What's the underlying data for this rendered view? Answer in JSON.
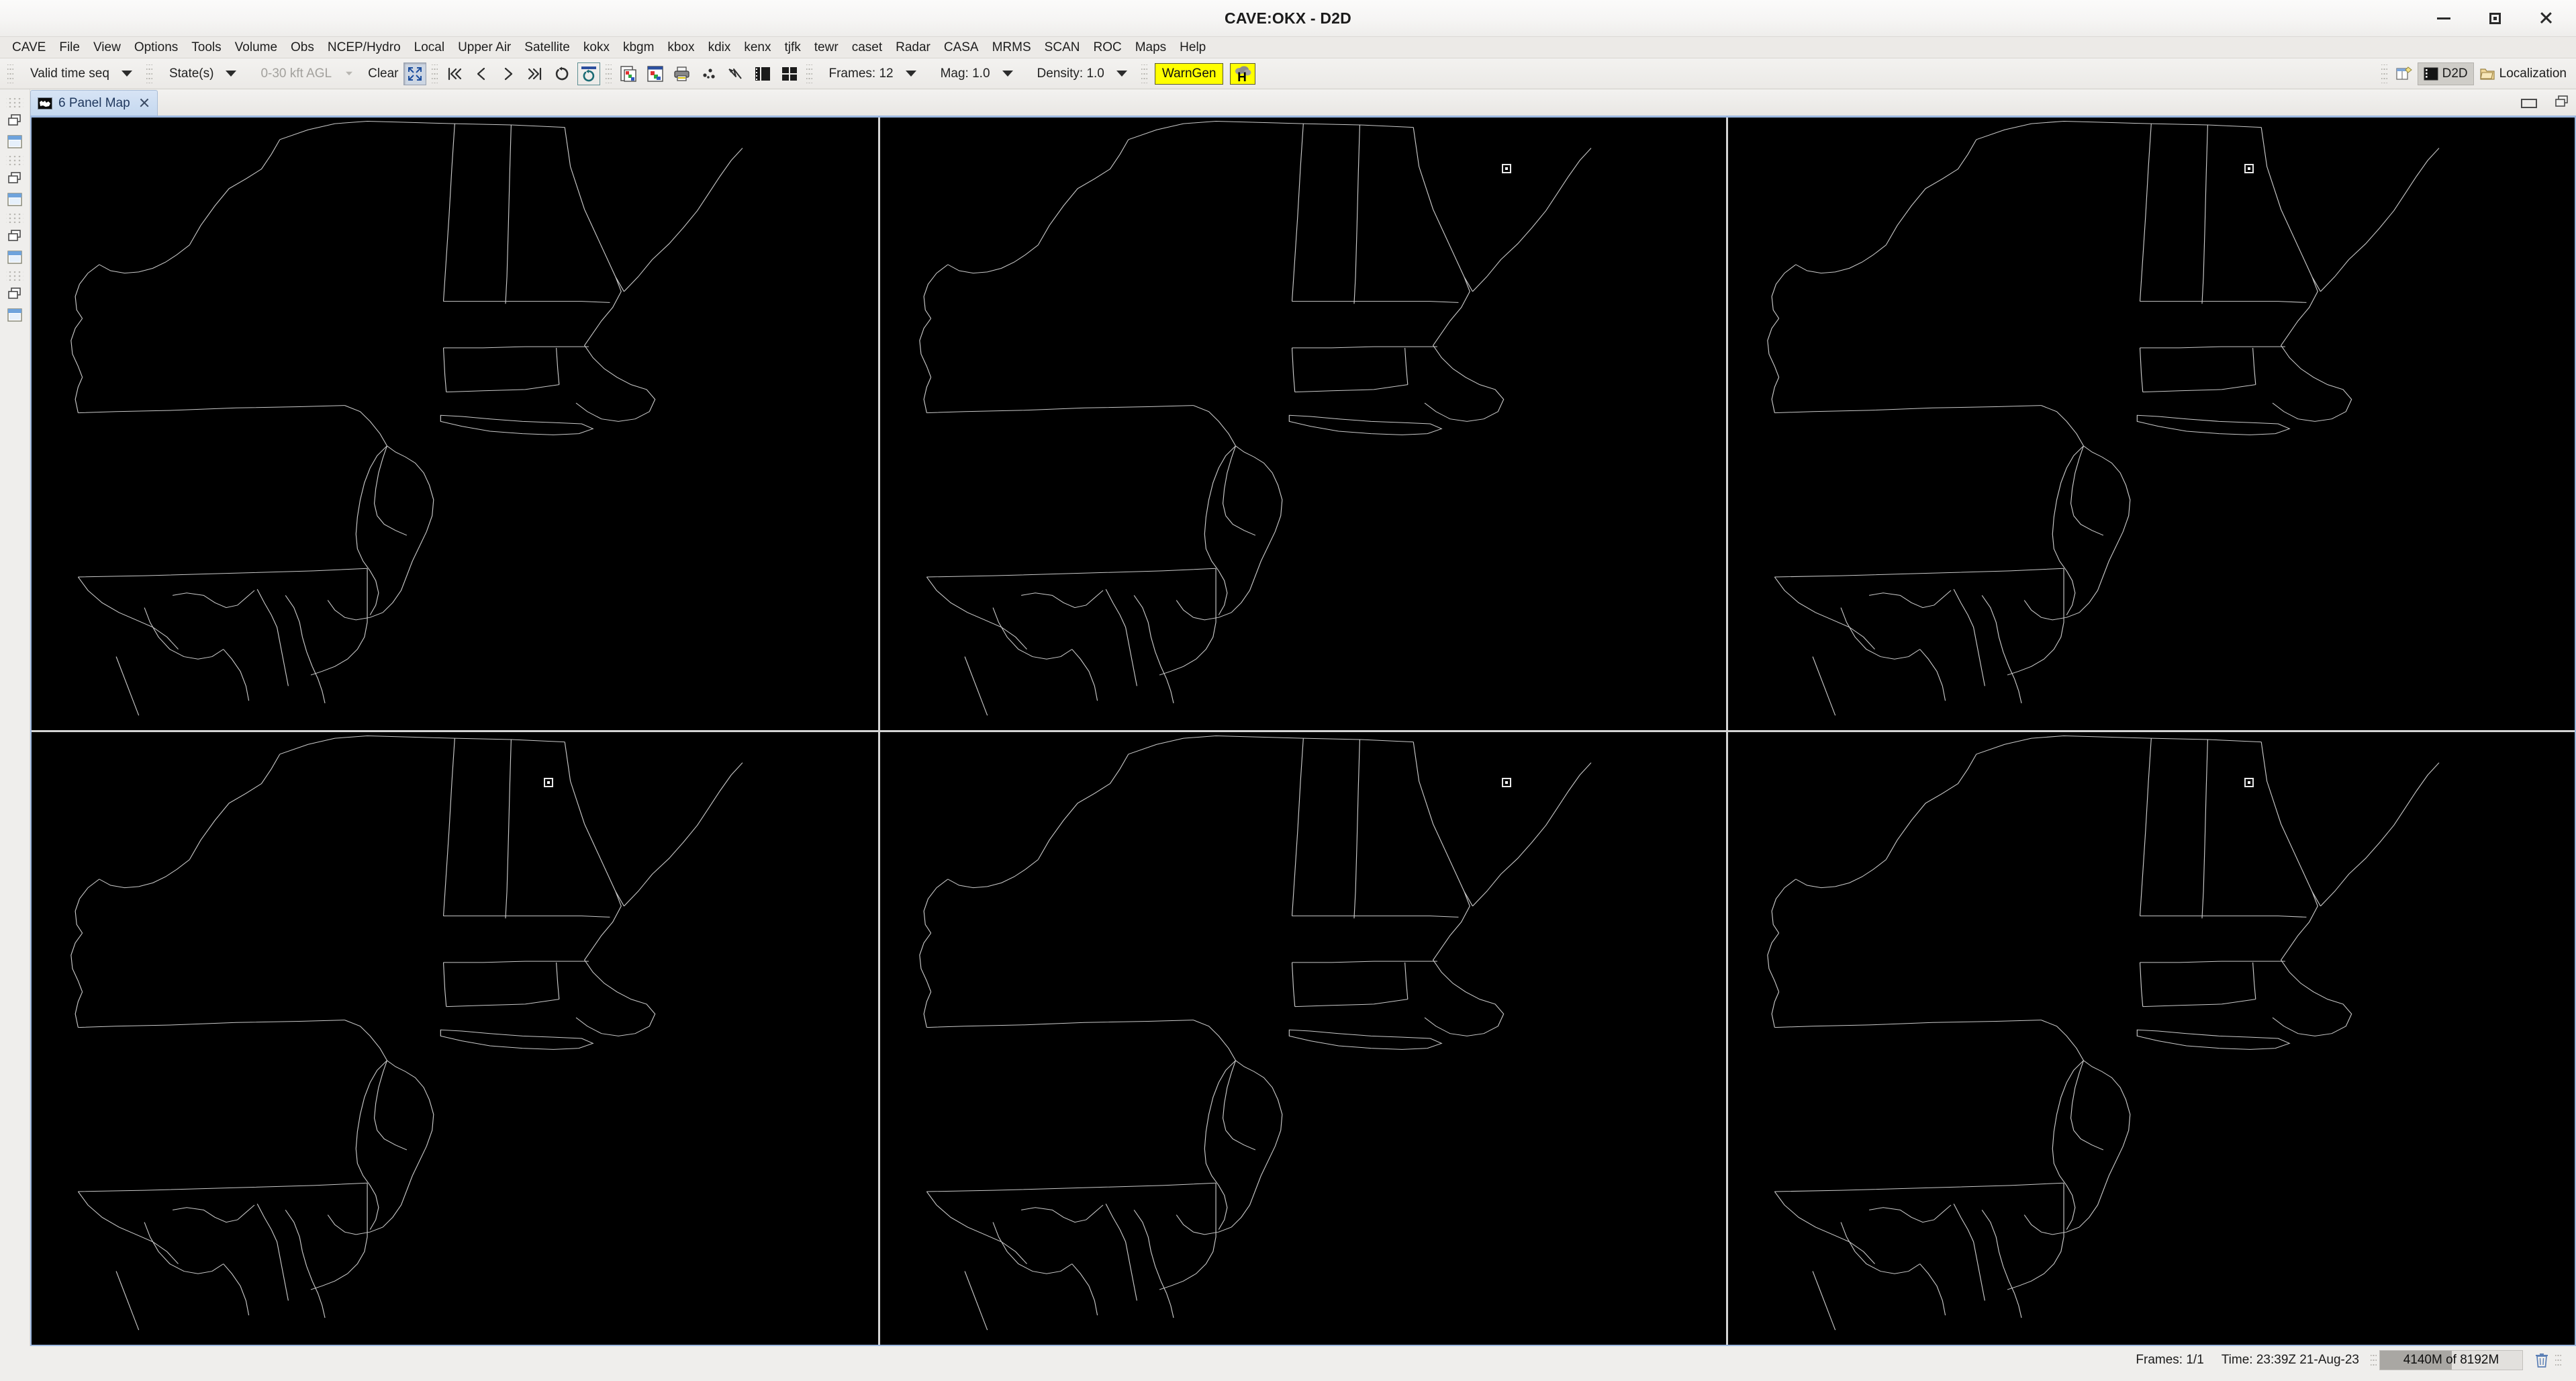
{
  "window": {
    "title": "CAVE:OKX - D2D",
    "controls": [
      {
        "name": "minimize-button",
        "label": "Minimize"
      },
      {
        "name": "maximize-button",
        "label": "Maximize"
      },
      {
        "name": "close-button",
        "label": "Close"
      }
    ]
  },
  "menubar": {
    "items": [
      {
        "label": "CAVE"
      },
      {
        "label": "File"
      },
      {
        "label": "View"
      },
      {
        "label": "Options"
      },
      {
        "label": "Tools"
      },
      {
        "label": "Volume"
      },
      {
        "label": "Obs"
      },
      {
        "label": "NCEP/Hydro"
      },
      {
        "label": "Local"
      },
      {
        "label": "Upper Air"
      },
      {
        "label": "Satellite"
      },
      {
        "label": "kokx"
      },
      {
        "label": "kbgm"
      },
      {
        "label": "kbox"
      },
      {
        "label": "kdix"
      },
      {
        "label": "kenx"
      },
      {
        "label": "tjfk"
      },
      {
        "label": "tewr"
      },
      {
        "label": "caset"
      },
      {
        "label": "Radar"
      },
      {
        "label": "CASA"
      },
      {
        "label": "MRMS"
      },
      {
        "label": "SCAN"
      },
      {
        "label": "ROC"
      },
      {
        "label": "Maps"
      },
      {
        "label": "Help"
      }
    ]
  },
  "toolbar": {
    "time_mode": "Valid time seq",
    "states": "State(s)",
    "altitude": "0-30 kft AGL",
    "clear": "Clear",
    "frames": "Frames: 12",
    "magnification": "Mag: 1.0",
    "density": "Density: 1.0",
    "warngen": "WarnGen",
    "hazard_icon_letter": "H",
    "perspective_d2d": "D2D",
    "perspective_localization": "Localization",
    "icons": [
      {
        "name": "fit-to-screen-icon",
        "state": "pressed"
      },
      {
        "name": "first-frame-icon"
      },
      {
        "name": "previous-frame-icon"
      },
      {
        "name": "next-frame-icon"
      },
      {
        "name": "last-frame-icon"
      },
      {
        "name": "loop-icon"
      },
      {
        "name": "auto-update-icon",
        "state": "selected"
      },
      {
        "name": "image-properties-icon"
      },
      {
        "name": "image-combine-icon"
      },
      {
        "name": "print-icon"
      },
      {
        "name": "points-icon"
      },
      {
        "name": "baselines-icon"
      },
      {
        "name": "two-panel-layout-icon"
      },
      {
        "name": "four-panel-layout-icon"
      }
    ]
  },
  "tabs": [
    {
      "label": "6 Panel Map",
      "icon": "map-icon",
      "active": true
    }
  ],
  "panels": {
    "count": 6,
    "background": "#000000",
    "map_line_color": "#c9c9c9",
    "region": "US Northeast",
    "markers": [
      {
        "panel": 2,
        "x_pct": 73.5,
        "y_pct": 7.6
      },
      {
        "panel": 3,
        "x_pct": 61.0,
        "y_pct": 7.6
      },
      {
        "panel": 4,
        "x_pct": 60.5,
        "y_pct": 7.5
      },
      {
        "panel": 5,
        "x_pct": 73.5,
        "y_pct": 7.5
      },
      {
        "panel": 6,
        "x_pct": 61.0,
        "y_pct": 7.5
      }
    ]
  },
  "statusbar": {
    "frames": "Frames: 1/1",
    "time": "Time: 23:39Z 21-Aug-23",
    "memory": "4140M of 8192M",
    "memory_used_pct": 50.5,
    "trash_icon": "trash-icon"
  },
  "colors": {
    "accent_tab": "#9db8e0",
    "warngen_bg": "#ffff00",
    "panel_bg": "#000000",
    "chrome_bg": "#efeeec"
  }
}
